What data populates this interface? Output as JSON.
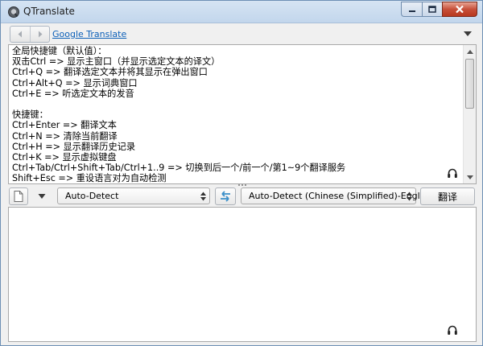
{
  "window": {
    "title": "QTranslate"
  },
  "toolbar": {
    "service_name": "Google Translate"
  },
  "source": {
    "lines": [
      "全局快捷键（默认值）：",
      "双击Ctrl => 显示主窗口（并显示选定文本的译文）",
      "Ctrl+Q => 翻译选定文本并将其显示在弹出窗口",
      "Ctrl+Alt+Q => 显示词典窗口",
      "Ctrl+E => 听选定文本的发音",
      "",
      "快捷键：",
      "Ctrl+Enter => 翻译文本",
      "Ctrl+N => 清除当前翻译",
      "Ctrl+H => 显示翻译历史记录",
      "Ctrl+K => 显示虚拟键盘",
      "Ctrl+Tab/Ctrl+Shift+Tab/Ctrl+1..9 => 切换到后一个/前一个/第1~9个翻译服务",
      "Shift+Esc => 重设语言对为自动检测"
    ]
  },
  "langbar": {
    "from_language": "Auto-Detect",
    "to_language": "Auto-Detect (Chinese (Simplified)-English)",
    "translate_label": "翻译"
  },
  "result": {
    "text": ""
  },
  "icons": {
    "app": "qtranslate-app-icon",
    "back": "arrow-left-icon",
    "forward": "arrow-right-icon",
    "menu": "chevron-down-icon",
    "listen": "headphones-icon",
    "swap": "swap-arrows-icon",
    "page": "blank-page-icon"
  },
  "colors": {
    "link": "#0b5fb8",
    "swap_arrows": "#3a8fc9",
    "close_button": "#c7503a"
  }
}
